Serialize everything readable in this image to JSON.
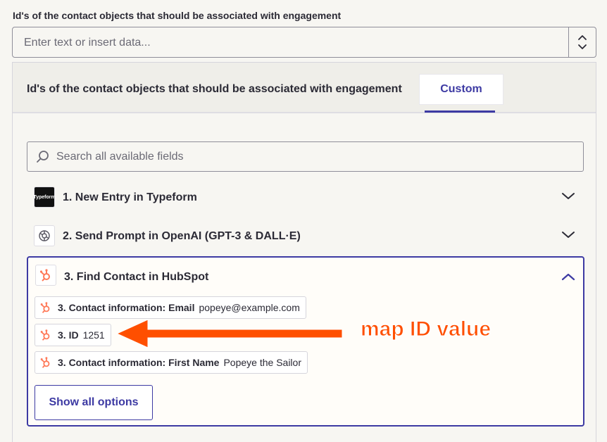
{
  "field": {
    "label": "Id's of the contact objects that should be associated with engagement",
    "placeholder": "Enter text or insert data..."
  },
  "panel": {
    "title": "Id's of the contact objects that should be associated with engagement",
    "tab_label": "Custom",
    "search_placeholder": "Search all available fields"
  },
  "steps": [
    {
      "label": "1. New Entry in Typeform",
      "icon": "typeform-icon",
      "expanded": false
    },
    {
      "label": "2. Send Prompt in OpenAI (GPT-3 & DALL·E)",
      "icon": "openai-icon",
      "expanded": false
    },
    {
      "label": "3. Find Contact in HubSpot",
      "icon": "hubspot-icon",
      "expanded": true
    }
  ],
  "options": [
    {
      "key": "3. Contact information: Email",
      "value": "popeye@example.com"
    },
    {
      "key": "3. ID",
      "value": "1251"
    },
    {
      "key": "3. Contact information: First Name",
      "value": "Popeye the Sailor"
    }
  ],
  "show_all_label": "Show all options",
  "annotation": "map ID value",
  "typeform_logo_text": "Typeform",
  "colors": {
    "accent": "#3d3aa3",
    "hubspot": "#ff7a59",
    "annotation": "#ff4f00",
    "background": "#f7f6f2"
  }
}
